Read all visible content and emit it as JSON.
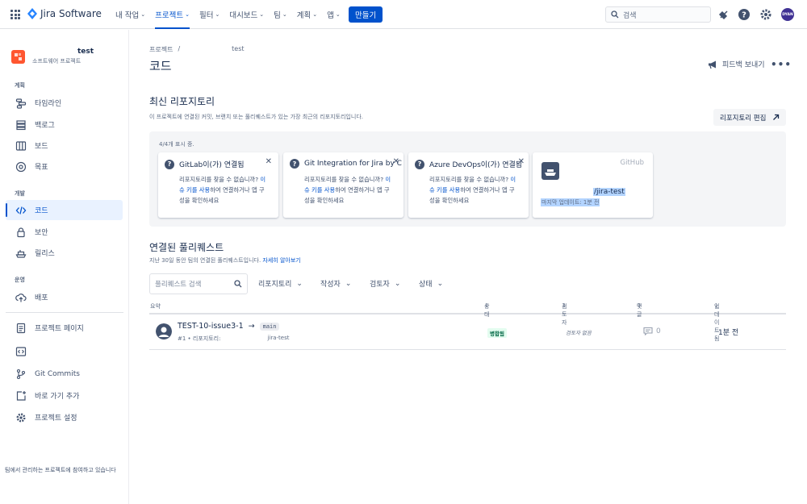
{
  "topnav": {
    "app_name": "Jira Software",
    "items": [
      {
        "label": "내 작업",
        "active": false
      },
      {
        "label": "프로젝트",
        "active": true
      },
      {
        "label": "필터",
        "active": false
      },
      {
        "label": "대시보드",
        "active": false
      },
      {
        "label": "팀",
        "active": false
      },
      {
        "label": "계획",
        "active": false
      },
      {
        "label": "앱",
        "active": false
      }
    ],
    "create_label": "만들기",
    "search_placeholder": "검색",
    "avatar_initials": "DYAN"
  },
  "sidebar": {
    "project_name": "test",
    "project_type": "소프트웨어 프로젝트",
    "sections": {
      "planning": "계획",
      "development": "개발",
      "operations": "운영"
    },
    "items": {
      "timeline": "타임라인",
      "backlog": "백로그",
      "board": "보드",
      "goals": "목표",
      "code": "코드",
      "security": "보안",
      "releases": "릴리스",
      "deployments": "배포",
      "project_pages": "프로젝트 페이지",
      "git_commits": "Git Commits",
      "add_shortcut": "바로 가기 추가",
      "project_settings": "프로젝트 설정"
    },
    "footer": "팀에서 관리하는 프로젝트에 참여하고 있습니다"
  },
  "main": {
    "breadcrumb_projects": "프로젝트",
    "breadcrumb_sep": "/",
    "breadcrumb_project": "test",
    "title": "코드",
    "feedback_label": "피드백 보내기",
    "more_label": "•••",
    "recent_repos": {
      "heading": "최신 리포지토리",
      "description": "이 프로젝트에 연결된 커밋, 브랜치 또는 풀리퀘스트가 있는 가장 최근의 리포지토리입니다.",
      "edit_label": "리포지토리 편집",
      "shown_count": "4/4개 표시 중.",
      "cards": [
        {
          "title": "GitLab이(가) 연결됨",
          "text_a": "리포지토리를 찾을 수 없습니까? ",
          "link_a": "이",
          "link_b": "슈 키를 사용",
          "text_b": "하여 연결하거나 앱 구",
          "text_c": "성을 확인하세요"
        },
        {
          "title": "Git Integration for Jira by C",
          "text_a": "리포지토리를 찾을 수 없습니까? ",
          "link_a": "이",
          "link_b": "슈 키를 사용",
          "text_b": "하여 연결하거나 앱 구",
          "text_c": "성을 확인하세요"
        },
        {
          "title": "Azure DevOps이(가) 연결됨",
          "text_a": "리포지토리를 찾을 수 없습니까? ",
          "link_a": "이",
          "link_b": "슈 키를 사용",
          "text_b": "하여 연결하거나 앱 구",
          "text_c": "성을 확인하세요"
        }
      ],
      "github": {
        "provider": "GitHub",
        "repo_name": "/jira-test",
        "updated": "마지막 업데이트: 1분 전"
      }
    },
    "pull_requests": {
      "heading": "연결된 풀리퀘스트",
      "description": "지난 30일 동안 팀의 연결된 풀리퀘스트입니다.",
      "learn_more": "자세히 알아보기",
      "search_placeholder": "풀리퀘스트 검색",
      "filters": [
        "리포지토리",
        "작성자",
        "검토자",
        "상태"
      ],
      "columns": {
        "summary": "요약",
        "status": "상태",
        "reviewer": "검토자",
        "comments": "댓글",
        "updated": "업데이트됨"
      },
      "rows": [
        {
          "title": "TEST-10-issue3-1",
          "arrow": "→",
          "branch": "main",
          "meta_id": "#1 • 리포지토리:",
          "repo": "jira-test",
          "status": "병합됨",
          "reviewer": "검토자 없음",
          "comments": "0",
          "updated": "1분 전"
        }
      ]
    }
  },
  "colors": {
    "primary": "#0052cc",
    "merged_bg": "#e3fcef",
    "merged_text": "#006644",
    "project_icon": "#ff5630"
  }
}
